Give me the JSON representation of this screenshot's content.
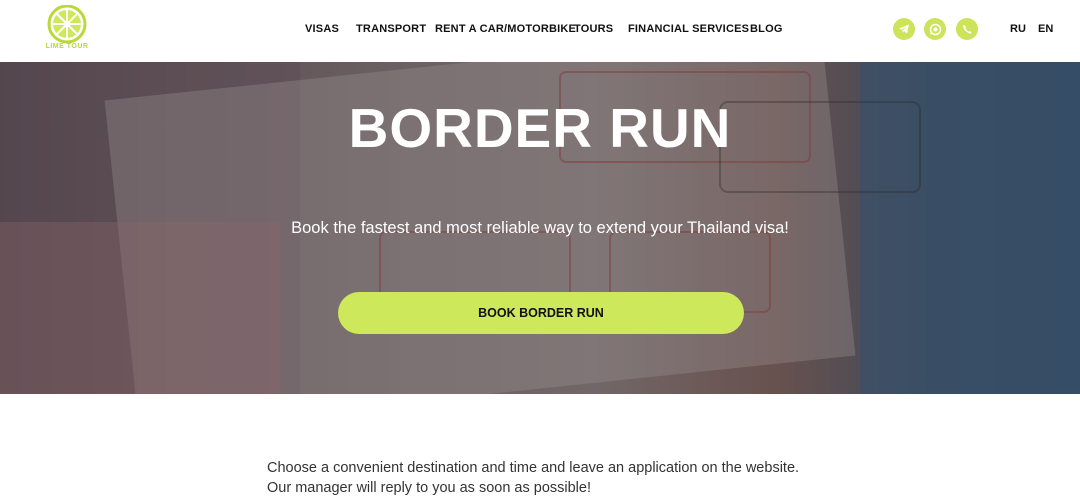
{
  "header": {
    "logo_text": "LIME TOUR",
    "nav": [
      {
        "label": "VISAS"
      },
      {
        "label": "TRANSPORT"
      },
      {
        "label": "RENT A CAR/MOTORBIKE"
      },
      {
        "label": "TOURS"
      },
      {
        "label": "FINANCIAL SERVICES"
      },
      {
        "label": "BLOG"
      }
    ],
    "social": [
      {
        "icon": "telegram-icon"
      },
      {
        "icon": "whatsapp-icon"
      },
      {
        "icon": "viber-icon"
      }
    ],
    "languages": [
      "RU",
      "EN"
    ]
  },
  "hero": {
    "title": "BORDER RUN",
    "subtitle": "Book the fastest and most reliable way to extend your Thailand visa!",
    "button_label": "BOOK BORDER RUN"
  },
  "content": {
    "intro_line1": "Choose a convenient destination and time and leave an application on the website.",
    "intro_line2": "Our manager will reply to you as soon as possible!"
  },
  "colors": {
    "accent": "#cde85a",
    "logo": "#b9d93a"
  }
}
